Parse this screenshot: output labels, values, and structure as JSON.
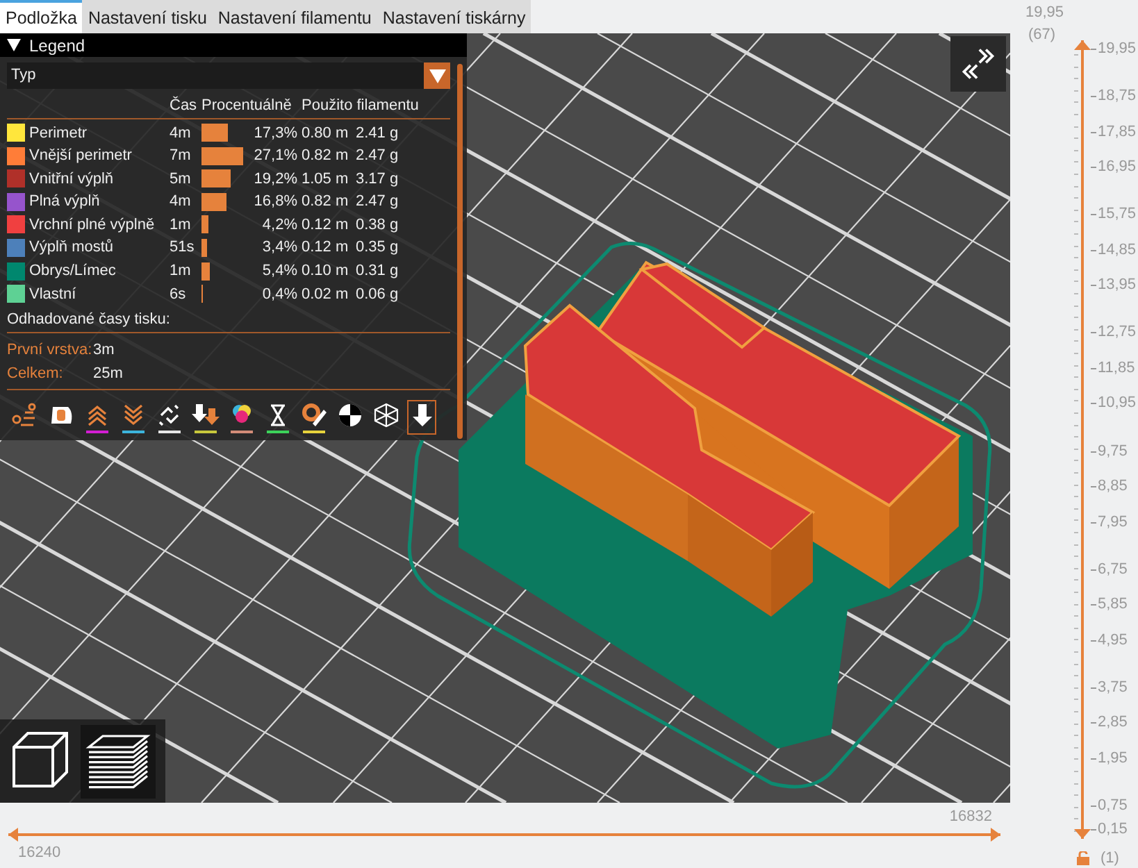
{
  "tabs": [
    {
      "label": "Podložka",
      "selected": true
    },
    {
      "label": "Nastavení tisku",
      "selected": false
    },
    {
      "label": "Nastavení filamentu",
      "selected": false
    },
    {
      "label": "Nastavení tiskárny",
      "selected": false
    }
  ],
  "legend": {
    "title": "Legend",
    "expanded": true,
    "view_type": "Typ",
    "columns": [
      "Čas",
      "Procentuálně",
      "Použito filamentu"
    ],
    "rows": [
      {
        "name": "Perimetr",
        "color": "#ffe63c",
        "time": "4m",
        "percent": "17,3%",
        "length": "0.80 m",
        "weight": "2.41 g"
      },
      {
        "name": "Vnější perimetr",
        "color": "#ff7d38",
        "time": "7m",
        "percent": "27,1%",
        "length": "0.82 m",
        "weight": "2.47 g"
      },
      {
        "name": "Vnitřní výplň",
        "color": "#b03029",
        "time": "5m",
        "percent": "19,2%",
        "length": "1.05 m",
        "weight": "3.17 g"
      },
      {
        "name": "Plná výplň",
        "color": "#9654cc",
        "time": "4m",
        "percent": "16,8%",
        "length": "0.82 m",
        "weight": "2.47 g"
      },
      {
        "name": "Vrchní plné výplně",
        "color": "#f04040",
        "time": "1m",
        "percent": "4,2%",
        "length": "0.12 m",
        "weight": "0.38 g"
      },
      {
        "name": "Výplň mostů",
        "color": "#4d80ba",
        "time": "51s",
        "percent": "3,4%",
        "length": "0.12 m",
        "weight": "0.35 g"
      },
      {
        "name": "Obrys/Límec",
        "color": "#00876e",
        "time": "1m",
        "percent": "5,4%",
        "length": "0.10 m",
        "weight": "0.31 g"
      },
      {
        "name": "Vlastní",
        "color": "#5ed194",
        "time": "6s",
        "percent": "0,4%",
        "length": "0.02 m",
        "weight": "0.06 g"
      }
    ],
    "estimates_title": "Odhadované časy tisku:",
    "estimates": [
      {
        "label": "První vrstva:",
        "value": "3m"
      },
      {
        "label": "Celkem:",
        "value": "25m"
      }
    ],
    "toolbar": [
      {
        "kind": "travel",
        "selected": false
      },
      {
        "kind": "wipe",
        "selected": false
      },
      {
        "kind": "retract",
        "color": "#d21ed2",
        "selected": false
      },
      {
        "kind": "deretract",
        "color": "#3cb4dc",
        "selected": false
      },
      {
        "kind": "seam",
        "color": "#e6e6e6",
        "selected": false
      },
      {
        "kind": "toolchange",
        "color": "#c8c83c",
        "selected": false
      },
      {
        "kind": "colorchange",
        "color": "#d28c78",
        "selected": false
      },
      {
        "kind": "pause",
        "color": "#3cd25a",
        "selected": false
      },
      {
        "kind": "custom",
        "color": "#e6d23c",
        "selected": false
      },
      {
        "kind": "gravity",
        "selected": false
      },
      {
        "kind": "shells",
        "selected": false
      },
      {
        "kind": "marker",
        "selected": true
      }
    ]
  },
  "vertical_slider": {
    "level": 1,
    "top_value": "19,95",
    "top_layer": "(67)",
    "bottom_layer": "(1)",
    "ticks": [
      "19,95",
      "18,75",
      "17,85",
      "16,95",
      "15,75",
      "14,85",
      "13,95",
      "12,75",
      "11,85",
      "10,95",
      "9,75",
      "8,85",
      "7,95",
      "6,75",
      "5,85",
      "4,95",
      "3,75",
      "2,85",
      "1,95",
      "0,75",
      "0,15"
    ]
  },
  "horizontal_slider": {
    "level": 1,
    "max_value": "16832",
    "min_value": "16240"
  }
}
